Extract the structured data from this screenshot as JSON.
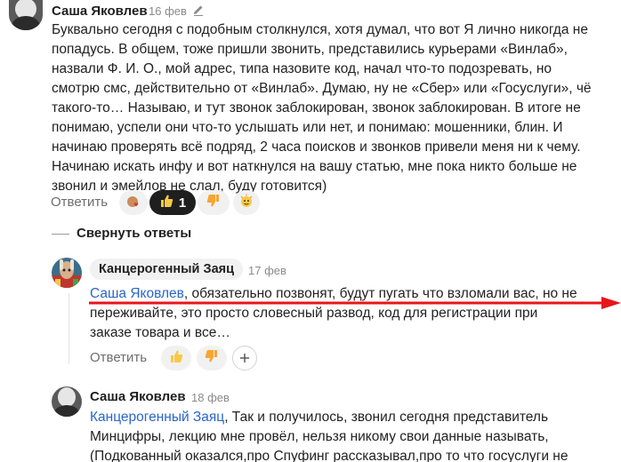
{
  "comment1": {
    "author": "Саша Яковлев",
    "date": "16 фев",
    "lines": [
      "Буквально сегодня с подобным столкнулся, хотя думал, что вот Я лично никогда не",
      "попадусь. В общем, тоже пришли звонить, представились курьерами «Винлаб»,",
      "назвали Ф. И. О., мой адрес, типа назовите код, начал что-то подозревать, но",
      "смотрю смс, действительно от «Винлаб». Думаю, ну не «Сбер» или «Госуслуги», чё",
      "такого-то… Называю, и тут звонок заблокирован, звонок заблокирован. В итоге не",
      "понимаю, успели они что-то услышать или нет, и понимаю: мошенники, блин. И",
      "начинаю проверять всё подряд, 2 часа поисков и звонков привели меня ни к чему.",
      "Начинаю искать инфу и вот наткнулся на вашу статью, мне пока никто больше не",
      "звонил и эмейлов не слал, буду готовится)"
    ],
    "reply_label": "Ответить",
    "like_count": "1",
    "icons": {
      "edit": "pencil-icon",
      "reactions": "heart-reactions-icon",
      "like": "thumbs-up-icon",
      "dislike": "thumbs-down-icon",
      "react": "emoji-react-icon"
    }
  },
  "collapse_label": "Свернуть ответы",
  "reply1": {
    "author": "Канцерогенный Заяц",
    "date": "17 фев",
    "mention": "Саша Яковлев",
    "line1_rest": ", обязательно позвонят, будут пугать что взломали вас, но не",
    "line2": "переживайте, это просто словесный развод, код для регистрации при",
    "line3": "заказе товара и все…",
    "reply_label": "Ответить",
    "icons": {
      "like": "thumbs-up-icon",
      "dislike": "thumbs-down-icon",
      "add": "plus-icon"
    }
  },
  "reply2": {
    "author": "Саша Яковлев",
    "date": "18 фев",
    "mention": "Канцерогенный Заяц",
    "line1_rest": ", Так и получилось, звонил сегодня представитель",
    "line2": "Минцифры, лекцию мне провёл, нельзя никому свои данные называть,",
    "line3": "(Подкованный оказался,про Спуфинг рассказывал,про то что госуслуги не"
  },
  "colors": {
    "link": "#2966c6",
    "annotation_arrow": "#e8141a",
    "dark_chip": "#1f1f1f"
  }
}
